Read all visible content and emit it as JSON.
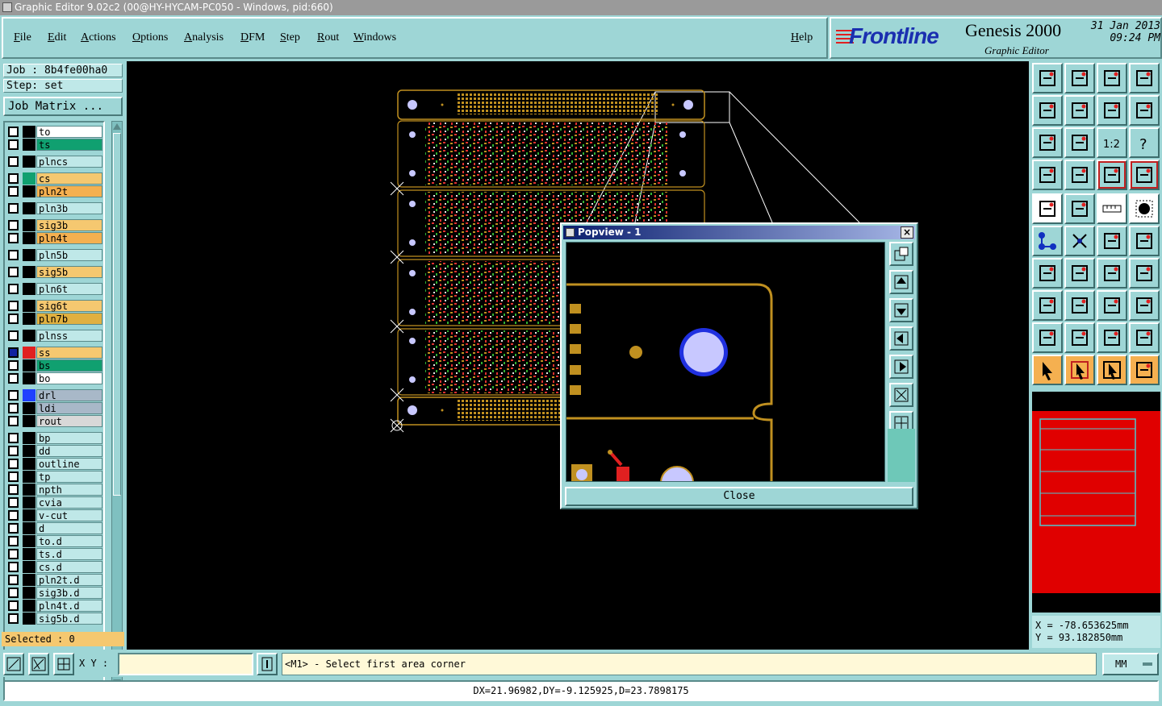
{
  "window": {
    "title": "Graphic Editor 9.02c2 (00@HY-HYCAM-PC050 - Windows, pid:660)"
  },
  "menu": {
    "items": [
      "File",
      "Edit",
      "Actions",
      "Options",
      "Analysis",
      "DFM",
      "Step",
      "Rout",
      "Windows"
    ],
    "help": "Help"
  },
  "brand": {
    "logo": "Frontline",
    "product": "Genesis 2000",
    "subtitle": "Graphic Editor",
    "date": "31 Jan 2013",
    "time": "09:24 PM"
  },
  "job": {
    "job_label": "Job : 8b4fe00ha0",
    "step_label": "Step: set",
    "matrix_button": "Job Matrix ..."
  },
  "layers": [
    {
      "name": "to",
      "color": "#ffffff"
    },
    {
      "name": "ts",
      "color": "#10a070"
    },
    {
      "name": "plncs",
      "color": "#bfe8e8"
    },
    {
      "name": "cs",
      "color": "#f5c870"
    },
    {
      "name": "pln2t",
      "color": "#f5b050"
    },
    {
      "name": "pln3b",
      "color": "#bfe8e8"
    },
    {
      "name": "sig3b",
      "color": "#f5c870"
    },
    {
      "name": "pln4t",
      "color": "#f5b050"
    },
    {
      "name": "pln5b",
      "color": "#bfe8e8"
    },
    {
      "name": "sig5b",
      "color": "#f5c870"
    },
    {
      "name": "pln6t",
      "color": "#bfe8e8"
    },
    {
      "name": "sig6t",
      "color": "#f5c870"
    },
    {
      "name": "pln7b",
      "color": "#e0b040"
    },
    {
      "name": "plnss",
      "color": "#bfe8e8"
    },
    {
      "name": "ss",
      "color": "#f5c870"
    },
    {
      "name": "bs",
      "color": "#10a070"
    },
    {
      "name": "bo",
      "color": "#ffffff"
    },
    {
      "name": "drl",
      "color": "#a8b8c8"
    },
    {
      "name": "ldi",
      "color": "#a8b8c8"
    },
    {
      "name": "rout",
      "color": "#d8d8d8"
    },
    {
      "name": "bp",
      "color": "#bfe8e8"
    },
    {
      "name": "dd",
      "color": "#bfe8e8"
    },
    {
      "name": "outline",
      "color": "#bfe8e8"
    },
    {
      "name": "tp",
      "color": "#bfe8e8"
    },
    {
      "name": "npth",
      "color": "#bfe8e8"
    },
    {
      "name": "cvia",
      "color": "#bfe8e8"
    },
    {
      "name": "v-cut",
      "color": "#bfe8e8"
    },
    {
      "name": "d",
      "color": "#bfe8e8"
    },
    {
      "name": "to.d",
      "color": "#bfe8e8"
    },
    {
      "name": "ts.d",
      "color": "#bfe8e8"
    },
    {
      "name": "cs.d",
      "color": "#bfe8e8"
    },
    {
      "name": "pln2t.d",
      "color": "#bfe8e8"
    },
    {
      "name": "sig3b.d",
      "color": "#bfe8e8"
    },
    {
      "name": "pln4t.d",
      "color": "#bfe8e8"
    },
    {
      "name": "sig5b.d",
      "color": "#bfe8e8"
    }
  ],
  "selected": "Selected : 0",
  "popview": {
    "title": "Popview - 1",
    "close_label": "Close"
  },
  "coords": {
    "x": "X = -78.653625mm",
    "y": "Y =  93.182850mm"
  },
  "status": {
    "xy_label": "X Y :",
    "xy_value": "",
    "prompt": "<M1> - Select first area corner",
    "units": "MM"
  },
  "measure": "DX=21.96982,DY=-9.125925,D=23.7898175"
}
